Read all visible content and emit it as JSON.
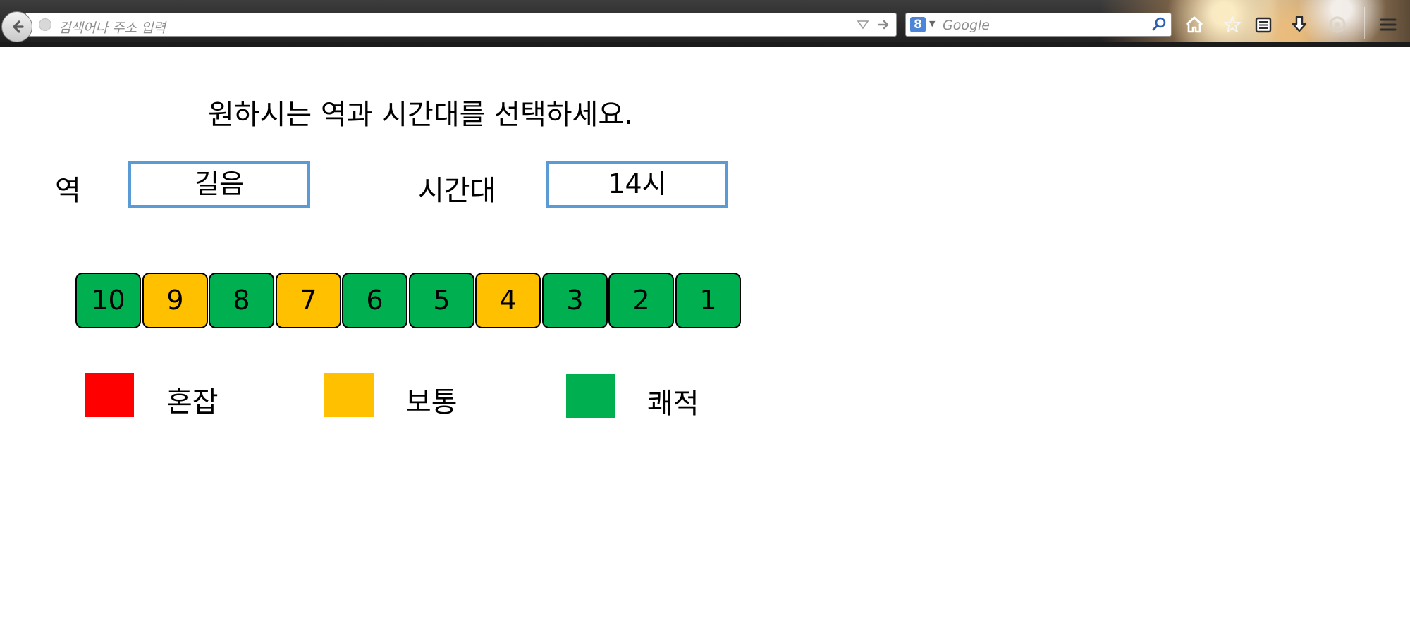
{
  "browser": {
    "url_placeholder": "검색어나 주소 입력",
    "search_engine_letter": "8",
    "search_placeholder": "Google"
  },
  "page": {
    "heading": "원하시는 역과 시간대를 선택하세요.",
    "station": {
      "label": "역",
      "value": "길음"
    },
    "time": {
      "label": "시간대",
      "value": "14시"
    }
  },
  "cars": [
    {
      "number": "10",
      "status": "comfortable"
    },
    {
      "number": "9",
      "status": "normal"
    },
    {
      "number": "8",
      "status": "comfortable"
    },
    {
      "number": "7",
      "status": "normal"
    },
    {
      "number": "6",
      "status": "comfortable"
    },
    {
      "number": "5",
      "status": "comfortable"
    },
    {
      "number": "4",
      "status": "normal"
    },
    {
      "number": "3",
      "status": "comfortable"
    },
    {
      "number": "2",
      "status": "comfortable"
    },
    {
      "number": "1",
      "status": "comfortable"
    }
  ],
  "legend": {
    "crowded": {
      "label": "혼잡",
      "color": "#FF0000"
    },
    "normal": {
      "label": "보통",
      "color": "#FFC000"
    },
    "comfortable": {
      "label": "쾌적",
      "color": "#00B050"
    }
  }
}
